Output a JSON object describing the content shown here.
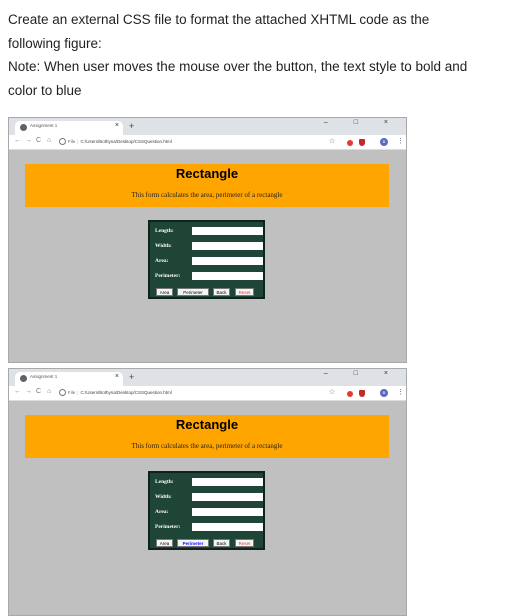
{
  "question": {
    "line1": "Create an external CSS file to format the attached XHTML code as the",
    "line2": "following figure:",
    "line3": "Note: When user moves the mouse over the button, the text style to bold and",
    "line4": "color to blue"
  },
  "browser": {
    "tab_title": "Assignment 1",
    "tab_close": "×",
    "new_tab": "+",
    "window_controls": "–  □  ×",
    "nav_back": "←",
    "nav_forward": "→",
    "nav_reload": "C",
    "nav_home": "⌂",
    "scheme": "File",
    "separator": "|",
    "url": "C:/Users/Bothyna/Desktop/CSSQuestion.html",
    "star": "☆",
    "avatar": "B",
    "menu": "⋮"
  },
  "page": {
    "heading": "Rectangle",
    "description": "This form calculates the area, perimeter of a rectangle",
    "fields": [
      {
        "label": "Length:"
      },
      {
        "label": "Width:"
      },
      {
        "label": "Area:"
      },
      {
        "label": "Perimeter:"
      }
    ],
    "buttons": [
      "Area",
      "Perimeter",
      "Back",
      "Reset"
    ]
  },
  "colors": {
    "header_bg": "#ffa500",
    "form_bg": "#1e4536",
    "viewport_bg": "#c0c0c0",
    "reset_text": "#e53935",
    "hover_text": "#1a0dff"
  },
  "state": {
    "top_screenshot_hovered_button": "none",
    "bottom_screenshot_hovered_button": "Perimeter"
  }
}
